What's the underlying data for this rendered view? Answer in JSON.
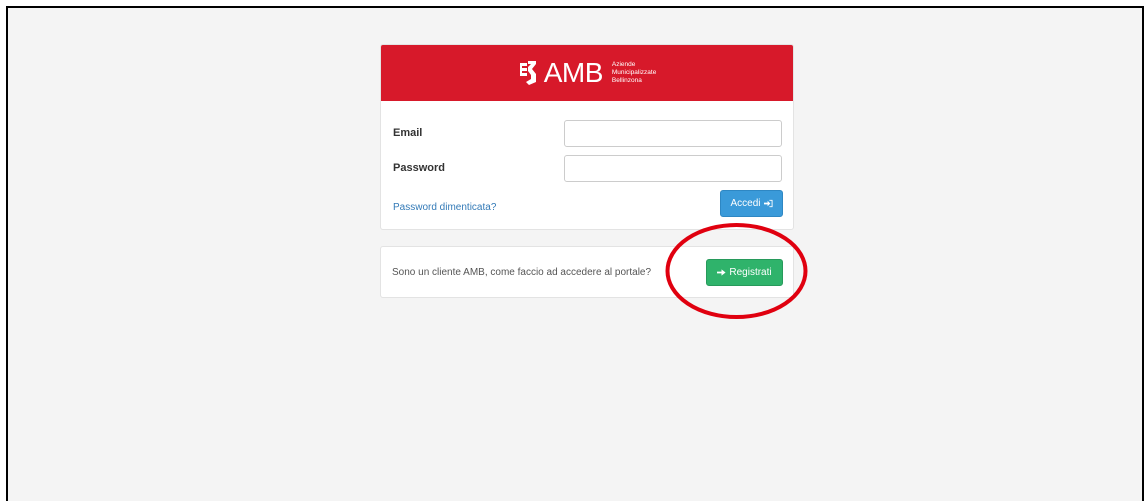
{
  "brand": {
    "name": "AMB",
    "tagline": [
      "Aziende",
      "Municipalizzate",
      "Bellinzona"
    ],
    "header_color": "#d7192a"
  },
  "login": {
    "email_label": "Email",
    "email_value": "",
    "password_label": "Password",
    "password_value": "",
    "forgot_link": "Password dimenticata?",
    "login_button": "Accedi",
    "login_icon": "sign-in-icon",
    "login_button_color": "#3a9ad9"
  },
  "register": {
    "question": "Sono un cliente AMB, come faccio ad accedere al portale?",
    "button": "Registrati",
    "button_icon": "arrow-right-icon",
    "button_color": "#2fb36b"
  },
  "annotation": {
    "shape": "ellipse",
    "target": "register-button",
    "color": "#e0000f"
  }
}
